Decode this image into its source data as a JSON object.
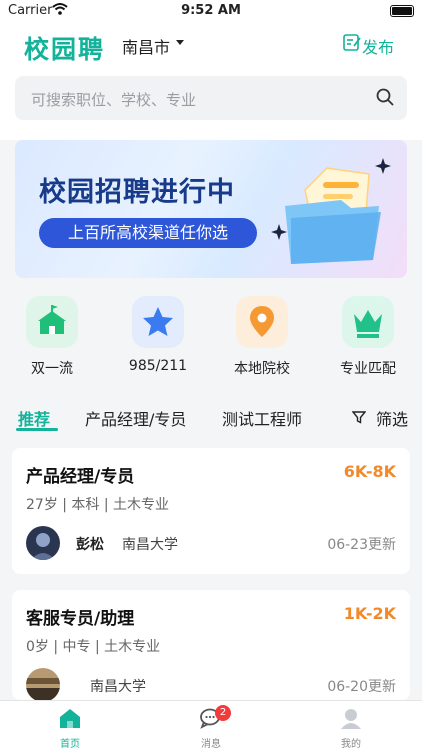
{
  "status_bar": {
    "carrier": "Carrier",
    "time": "9:52 AM"
  },
  "header": {
    "logo": "校园聘",
    "city": "南昌市",
    "publish_label": "发布",
    "search_placeholder": "可搜索职位、学校、专业"
  },
  "banner": {
    "title": "校园招聘进行中",
    "subtitle": "上百所高校渠道任你选"
  },
  "categories": [
    {
      "label": "双一流",
      "icon": "school-icon",
      "color": "#1fbf7a"
    },
    {
      "label": "985/211",
      "icon": "star-icon",
      "color": "#3a7bf0"
    },
    {
      "label": "本地院校",
      "icon": "location-pin-icon",
      "color": "#f59a33"
    },
    {
      "label": "专业匹配",
      "icon": "crown-icon",
      "color": "#22c08a"
    }
  ],
  "tabs": {
    "items": [
      "推荐",
      "产品经理/专员",
      "测试工程师"
    ],
    "active": 0,
    "filter_label": "筛选"
  },
  "jobs": [
    {
      "title": "产品经理/专员",
      "salary": "6K-8K",
      "meta": "27岁 | 本科 | 土木专业",
      "person": "彭松",
      "school": "南昌大学",
      "updated": "06-23更新"
    },
    {
      "title": "客服专员/助理",
      "salary": "1K-2K",
      "meta": "0岁 | 中专 | 土木专业",
      "person": "",
      "school": "南昌大学",
      "updated": "06-20更新"
    }
  ],
  "tabbar": {
    "items": [
      {
        "label": "首页",
        "icon": "home-icon"
      },
      {
        "label": "消息",
        "icon": "message-icon",
        "badge": "2"
      },
      {
        "label": "我的",
        "icon": "profile-icon"
      }
    ],
    "active": 0
  },
  "colors": {
    "accent": "#12b39a",
    "salary": "#f08a2a",
    "badge": "#f23c3c"
  }
}
